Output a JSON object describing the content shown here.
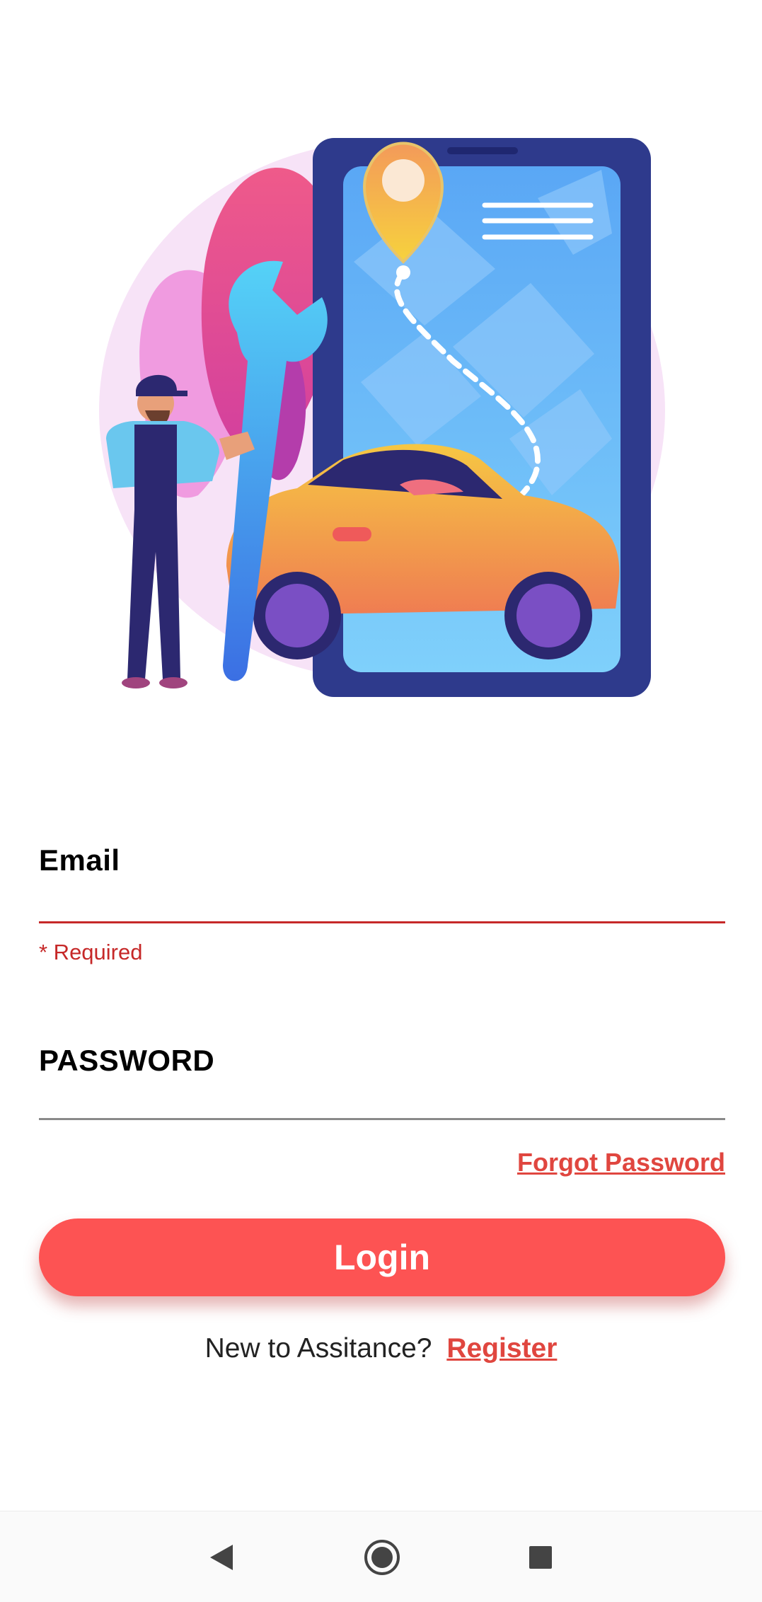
{
  "login_form": {
    "email_label": "Email",
    "email_error": "* Required",
    "password_label": "PASSWORD",
    "forgot_password": "Forgot Password",
    "login_button": "Login",
    "register_prompt": "New to Assitance?",
    "register_link": "Register"
  },
  "nav_bar": {
    "back_icon": "back-triangle-icon",
    "home_icon": "home-circle-icon",
    "recents_icon": "recents-square-icon"
  },
  "colors": {
    "accent": "#fd5353",
    "link": "#e0463f",
    "error": "#c62828"
  }
}
